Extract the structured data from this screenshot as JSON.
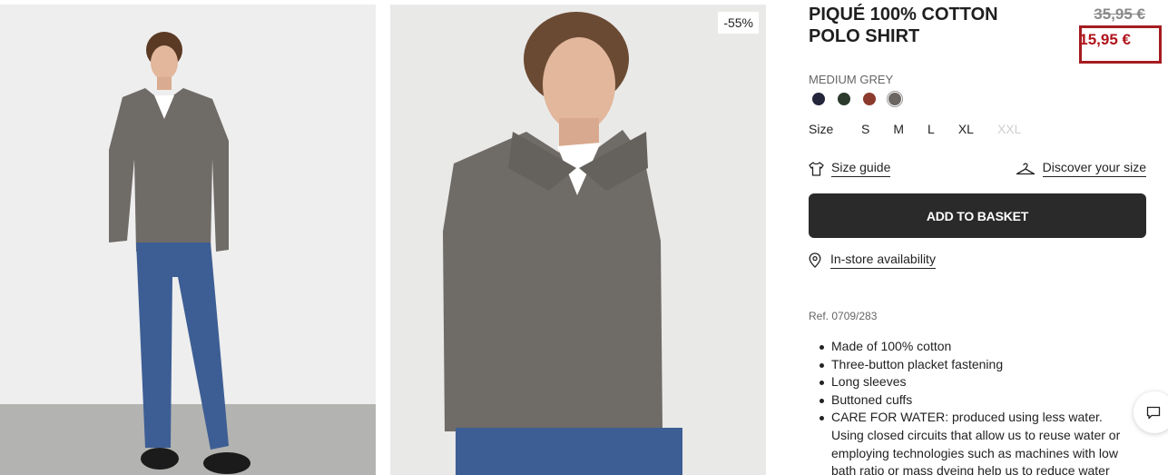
{
  "product": {
    "title": "PIQUÉ 100% COTTON POLO SHIRT",
    "old_price": "35,95 €",
    "new_price": "15,95 €",
    "discount": "-55%",
    "color_name": "MEDIUM GREY",
    "colors": [
      {
        "name": "navy",
        "hex": "#23263a"
      },
      {
        "name": "dark-green",
        "hex": "#2c3a2e"
      },
      {
        "name": "rust",
        "hex": "#8c3a2d"
      },
      {
        "name": "medium-grey",
        "hex": "#6c6663",
        "selected": true
      }
    ],
    "size_label": "Size",
    "sizes": [
      "S",
      "M",
      "L",
      "XL",
      "XXL"
    ],
    "size_guide_label": "Size guide",
    "discover_size_label": "Discover your size",
    "add_to_basket_label": "ADD TO BASKET",
    "store_availability_label": "In-store availability",
    "reference": "Ref. 0709/283",
    "features": [
      "Made of 100% cotton",
      "Three-button placket fastening",
      "Long sleeves",
      "Buttoned cuffs",
      "CARE FOR WATER: produced using less water. Using closed circuits that allow us to reuse water or employing technologies such as machines with low bath ratio or mass dyeing help us to reduce water"
    ]
  },
  "icons": {
    "size_guide": "tshirt-icon",
    "discover_size": "hanger-icon",
    "store": "location-pin-icon",
    "chat": "chat-icon"
  },
  "colors": {
    "sale_red": "#b0141b",
    "button_dark": "#2a2a2a"
  }
}
